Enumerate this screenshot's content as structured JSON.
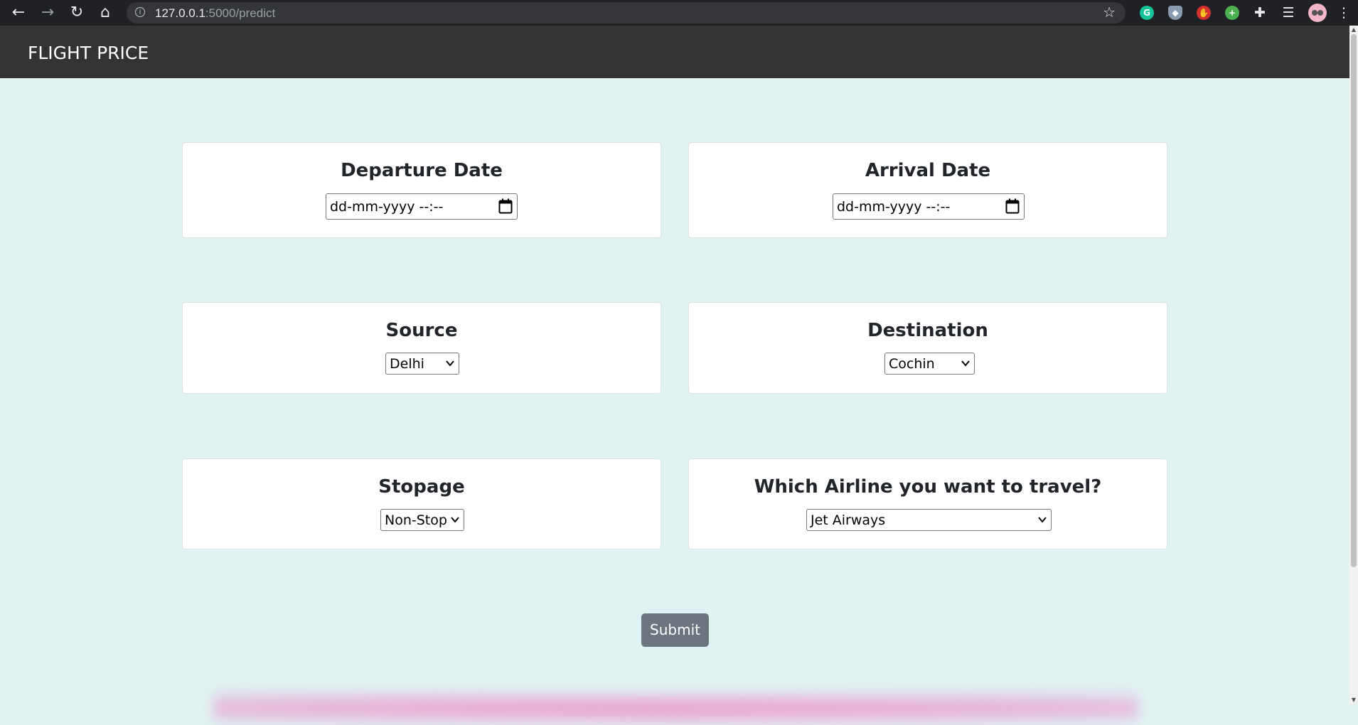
{
  "browser": {
    "url_host": "127.0.0.1",
    "url_path": ":5000/predict",
    "info_glyph": "i",
    "back_glyph": "←",
    "forward_glyph": "→",
    "reload_glyph": "↻",
    "home_glyph": "⌂",
    "star_glyph": "☆",
    "extensions": [
      {
        "name": "grammarly-icon",
        "glyph": "G",
        "color": "#15c39a"
      },
      {
        "name": "shield-extension-icon",
        "glyph": "◆",
        "color": "#8a9ab0"
      },
      {
        "name": "adblock-icon",
        "glyph": "✋",
        "color": "#d32f2f"
      },
      {
        "name": "green-plus-extension-icon",
        "glyph": "+",
        "color": "#4caf50"
      }
    ],
    "puzzle_glyph": "✚",
    "playlist_glyph": "☰",
    "menu_glyph": "⋮"
  },
  "navbar": {
    "brand": "FLIGHT PRICE"
  },
  "form": {
    "departure": {
      "label": "Departure Date",
      "value": "dd-mm-yyyy --:--"
    },
    "arrival": {
      "label": "Arrival Date",
      "value": "dd-mm-yyyy --:--"
    },
    "source": {
      "label": "Source",
      "value": "Delhi"
    },
    "destination": {
      "label": "Destination",
      "value": "Cochin"
    },
    "stopage": {
      "label": "Stopage",
      "value": "Non-Stop"
    },
    "airline": {
      "label": "Which Airline you want to travel?",
      "value": "Jet Airways"
    },
    "submit_label": "Submit"
  },
  "colors": {
    "page_bg": "#e0f2f1",
    "navbar_bg": "#333333",
    "submit_bg": "#6c757d"
  }
}
